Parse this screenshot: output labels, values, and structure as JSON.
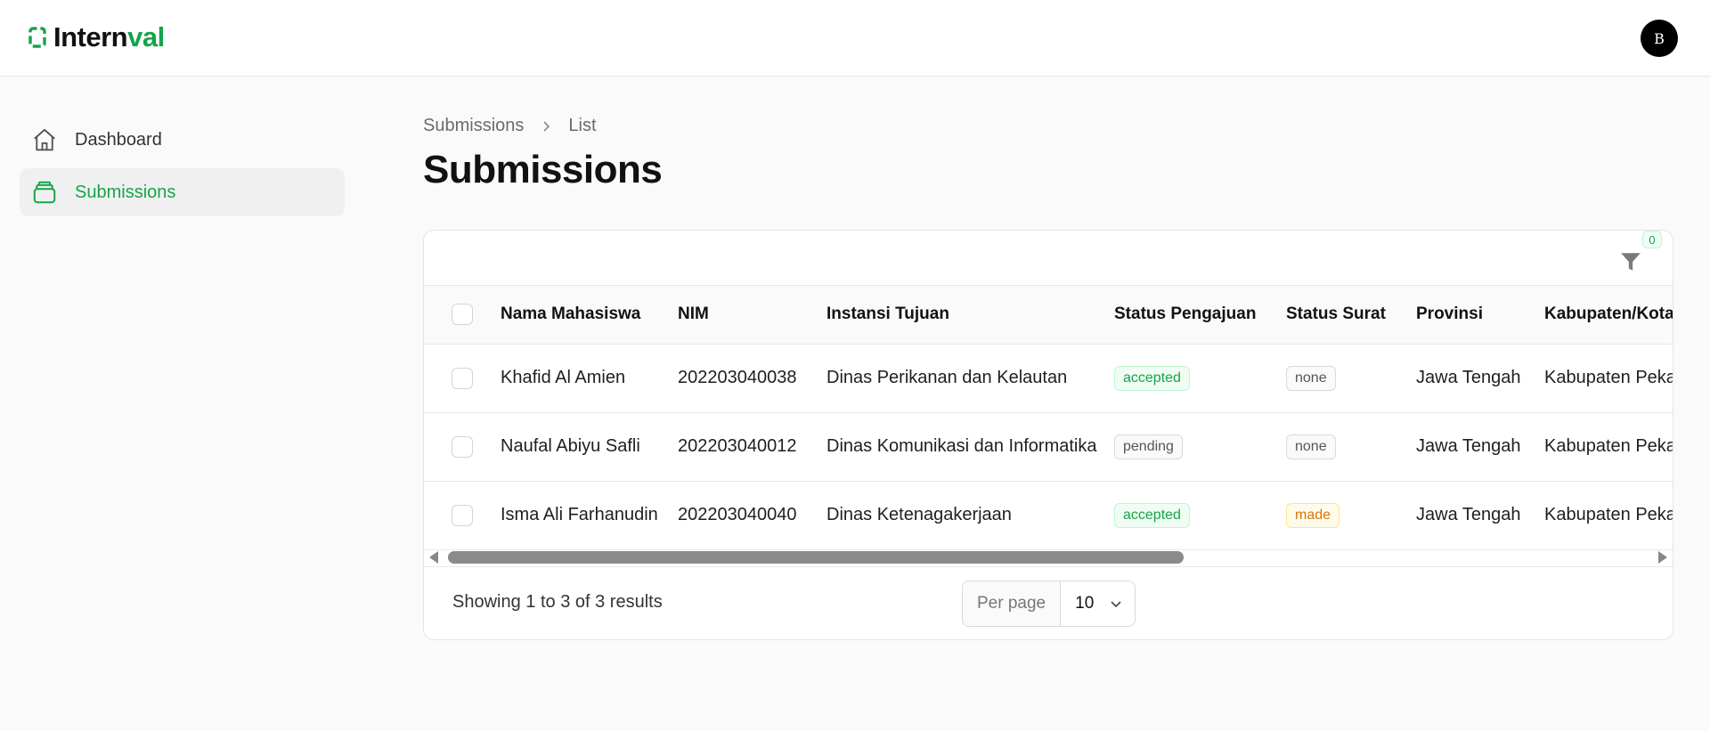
{
  "app": {
    "brand_prefix": "Intern",
    "brand_accent": "val",
    "avatar_initial": "B",
    "accent_color": "#16a34a"
  },
  "sidebar": {
    "items": [
      {
        "label": "Dashboard",
        "icon": "home-icon",
        "active": false
      },
      {
        "label": "Submissions",
        "icon": "stack-icon",
        "active": true
      }
    ]
  },
  "breadcrumb": {
    "items": [
      "Submissions",
      "List"
    ]
  },
  "page": {
    "title": "Submissions"
  },
  "filters": {
    "active_count": "0"
  },
  "table": {
    "columns": [
      "Nama Mahasiswa",
      "NIM",
      "Instansi Tujuan",
      "Status Pengajuan",
      "Status Surat",
      "Provinsi",
      "Kabupaten/Kota"
    ],
    "rows": [
      {
        "nama": "Khafid Al Amien",
        "nim": "202203040038",
        "instansi": "Dinas Perikanan dan Kelautan",
        "status_pengajuan": "accepted",
        "status_surat": "none",
        "provinsi": "Jawa Tengah",
        "kabupaten": "Kabupaten Pekalongan"
      },
      {
        "nama": "Naufal Abiyu Safli",
        "nim": "202203040012",
        "instansi": "Dinas Komunikasi dan Informatika",
        "status_pengajuan": "pending",
        "status_surat": "none",
        "provinsi": "Jawa Tengah",
        "kabupaten": "Kabupaten Pekalongan"
      },
      {
        "nama": "Isma Ali Farhanudin",
        "nim": "202203040040",
        "instansi": "Dinas Ketenagakerjaan",
        "status_pengajuan": "accepted",
        "status_surat": "made",
        "provinsi": "Jawa Tengah",
        "kabupaten": "Kabupaten Pekalongan"
      }
    ]
  },
  "pagination": {
    "summary": "Showing 1 to 3 of 3 results",
    "per_page_label": "Per page",
    "per_page_value": "10"
  }
}
